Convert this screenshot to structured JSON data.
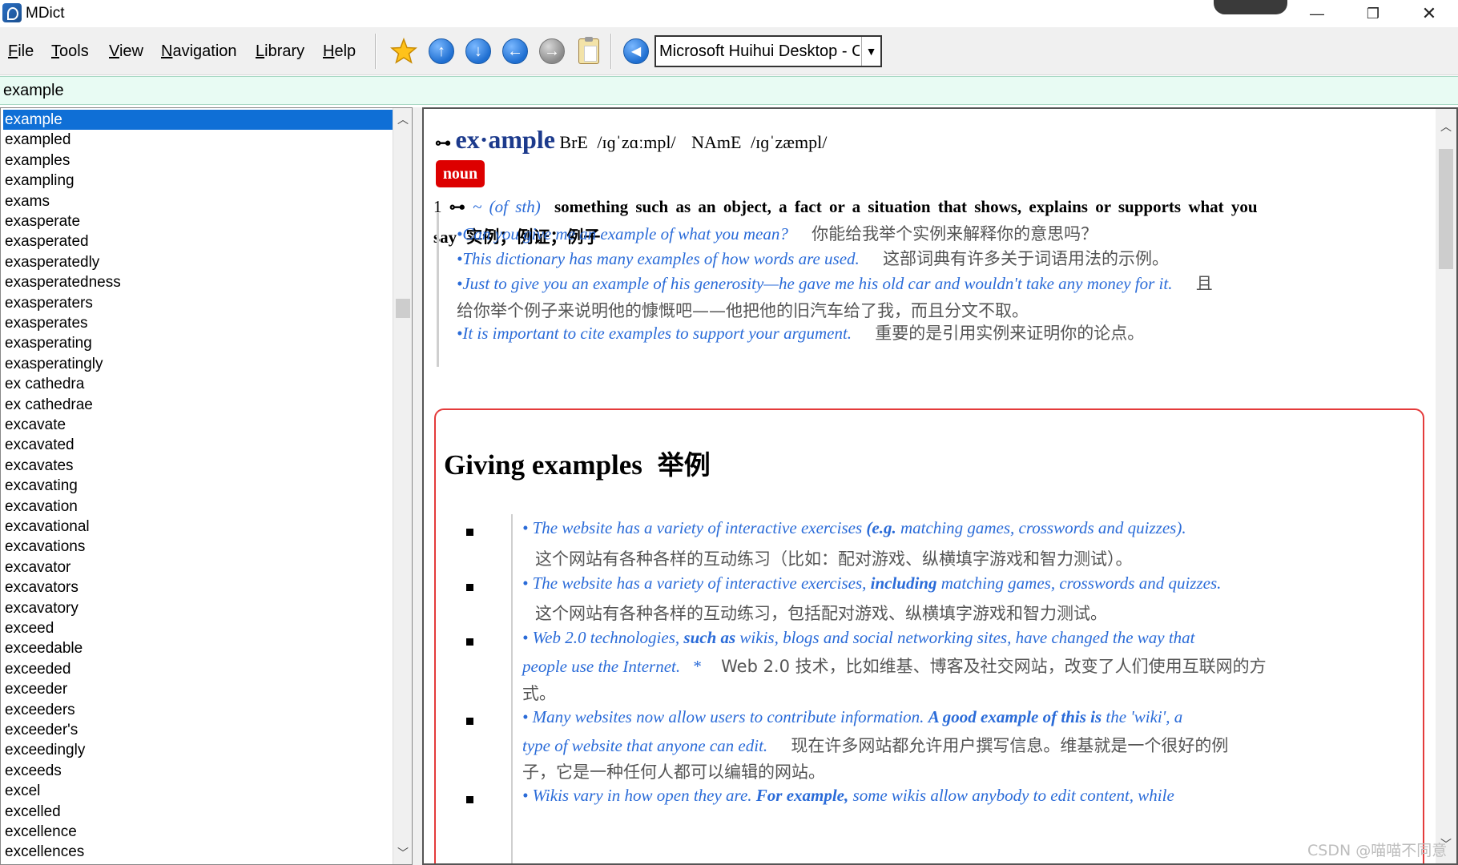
{
  "window": {
    "title": "MDict",
    "minimize": "—",
    "maximize": "❐",
    "close": "✕"
  },
  "menu": [
    "File",
    "Tools",
    "View",
    "Navigation",
    "Library",
    "Help"
  ],
  "toolbar": {
    "font_select_value": "Microsoft Huihui Desktop - C"
  },
  "search": {
    "value": "example"
  },
  "wordlist": {
    "selected": "example",
    "items": [
      "example",
      "exampled",
      "examples",
      "exampling",
      "exams",
      "exasperate",
      "exasperated",
      "exasperatedly",
      "exasperatedness",
      "exasperaters",
      "exasperates",
      "exasperating",
      "exasperatingly",
      "ex cathedra",
      "ex cathedrae",
      "excavate",
      "excavated",
      "excavates",
      "excavating",
      "excavation",
      "excavational",
      "excavations",
      "excavator",
      "excavators",
      "excavatory",
      "exceed",
      "exceedable",
      "exceeded",
      "exceeder",
      "exceeders",
      "exceeder's",
      "exceedingly",
      "exceeds",
      "excel",
      "excelled",
      "excellence",
      "excellences"
    ]
  },
  "entry": {
    "headword": "ex·ample",
    "pron_bre_label": "BrE",
    "pron_bre": "/ɪɡˈzɑːmpl/",
    "pron_name_label": "NAmE",
    "pron_name": "/ɪɡˈzæmpl/",
    "pos": "noun",
    "sense_num": "1",
    "sense_tilde": "~",
    "sense_grammar": "(of sth)",
    "definition_1": "something such as an object, a fact or a situation that shows, explains or supports what you",
    "definition_2": "say",
    "definition_cn": "实例；例证；例子",
    "examples": [
      {
        "en": "•Can you give me an example of what you mean?",
        "cn": "你能给我举个实例来解释你的意思吗？"
      },
      {
        "en": "•This dictionary has many examples of how words are used.",
        "cn": "这部词典有许多关于词语用法的示例。"
      },
      {
        "en": "•Just to give you an example of his generosity—he gave me his old car and wouldn't take any money for it.",
        "cn_1": "且",
        "cn_2": "给你举个例子来说明他的慷慨吧——他把他的旧汽车给了我，而且分文不取。"
      },
      {
        "en": "•It is important to cite examples to support your argument.",
        "cn": "重要的是引用实例来证明你的论点。"
      }
    ]
  },
  "usage_box": {
    "title_en": "Giving examples",
    "title_cn": "举例",
    "items": [
      {
        "l1_pre": "• The website has a variety of interactive exercises ",
        "l1_bold": "(e.g.",
        "l1_post": " matching games, crosswords and quizzes).",
        "l2_cn": "这个网站有各种各样的互动练习（比如：配对游戏、纵横填字游戏和智力测试）。"
      },
      {
        "l1_pre": "• The website has a variety of interactive exercises, ",
        "l1_bold": "including",
        "l1_post": " matching games, crosswords and quizzes.",
        "l2_cn": "这个网站有各种各样的互动练习，包括配对游戏、纵横填字游戏和智力测试。"
      },
      {
        "l1_pre": "• Web 2.0 technologies, ",
        "l1_bold": "such as",
        "l1_post": " wikis, blogs and social networking sites, have changed the way that",
        "l2_en": "people use the Internet.",
        "l2_star": "*",
        "l2_cn": "Web 2.0 技术，比如维基、博客及社交网站，改变了人们使用互联网的方",
        "l3_cn": "式。"
      },
      {
        "l1_pre": "• Many websites now allow users to contribute information. ",
        "l1_bold": "A good example of this is",
        "l1_post": " the 'wiki', a",
        "l2_en": "type of website that anyone can edit.",
        "l2_cn": "现在许多网站都允许用户撰写信息。维基就是一个很好的例",
        "l3_cn": "子，它是一种任何人都可以编辑的网站。"
      },
      {
        "l1_pre": "• Wikis vary in how open they are. ",
        "l1_bold": "For example,",
        "l1_post": " some wikis allow anybody to edit content, while"
      }
    ]
  },
  "watermark": "CSDN @喵喵不同意"
}
